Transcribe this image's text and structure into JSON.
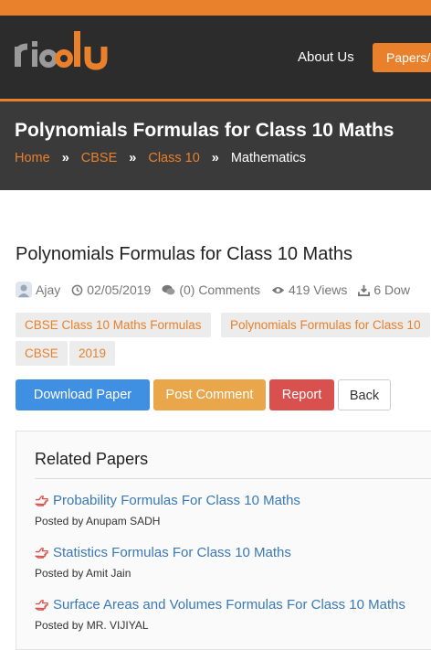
{
  "header": {
    "logo_text": "riddlu",
    "nav": {
      "about": "About Us",
      "papers": "Papers/"
    }
  },
  "banner": {
    "title": "Polynomials Formulas for Class 10 Maths",
    "breadcrumbs": [
      "Home",
      "CBSE",
      "Class 10",
      "Mathematics"
    ],
    "separator": "»"
  },
  "article": {
    "title": "Polynomials Formulas for Class 10 Maths",
    "meta": {
      "author": "Ajay",
      "date": "02/05/2019",
      "comments": "(0) Comments",
      "views": "419 Views",
      "downloads": "6 Dow"
    },
    "tags": [
      "CBSE Class 10 Maths Formulas",
      "Polynomials Formulas for Class 10",
      "CBSE",
      "2019"
    ],
    "buttons": {
      "download": "Download Paper",
      "post_comment": "Post Comment",
      "report": "Report",
      "back": "Back"
    }
  },
  "related": {
    "title": "Related Papers",
    "items": [
      {
        "title": "Probability Formulas For Class 10 Maths",
        "posted_by": "Posted by Anupam SADH"
      },
      {
        "title": "Statistics Formulas For Class 10 Maths",
        "posted_by": "Posted by Amit Jain"
      },
      {
        "title": "Surface Areas and Volumes Formulas For Class 10 Maths",
        "posted_by": "Posted by MR. VIJIYAL"
      }
    ]
  },
  "colors": {
    "accent_orange": "#e8802c",
    "header_dark": "#2c2c2c",
    "download_blue": "#3f8fe3",
    "comment_amber": "#eaa64b",
    "report_red": "#d9514e",
    "link_blue": "#3a79b5"
  },
  "icons": {
    "author": "user-avatar-icon",
    "date": "clock-icon",
    "comments": "comments-icon",
    "views": "eye-icon",
    "downloads": "download-icon",
    "related_item": "hand-pointing-right-icon"
  }
}
